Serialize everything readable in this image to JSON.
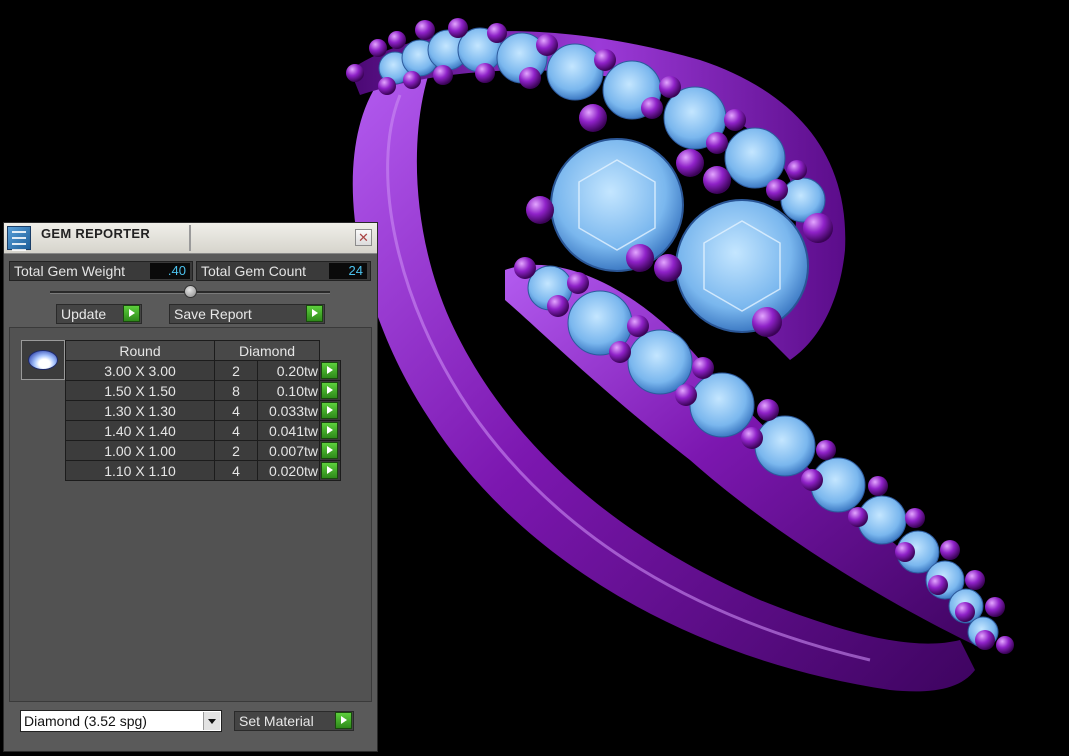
{
  "window": {
    "title": "GEM REPORTER",
    "close_glyph": "✕",
    "app_icon": "gem-reporter-icon"
  },
  "stats": {
    "total_weight_label": "Total Gem Weight",
    "total_weight_value": ".40",
    "total_count_label": "Total Gem Count",
    "total_count_value": "24"
  },
  "buttons": {
    "update": "Update",
    "save_report": "Save Report",
    "set_material": "Set Material"
  },
  "table": {
    "headers": {
      "shape": "Round",
      "material": "Diamond"
    },
    "rows": [
      {
        "size": "3.00 X 3.00",
        "count": "2",
        "weight": "0.20tw"
      },
      {
        "size": "1.50 X 1.50",
        "count": "8",
        "weight": "0.10tw"
      },
      {
        "size": "1.30 X 1.30",
        "count": "4",
        "weight": "0.033tw"
      },
      {
        "size": "1.40 X 1.40",
        "count": "4",
        "weight": "0.041tw"
      },
      {
        "size": "1.00 X 1.00",
        "count": "2",
        "weight": "0.007tw"
      },
      {
        "size": "1.10 X 1.10",
        "count": "4",
        "weight": "0.020tw"
      }
    ]
  },
  "material_select": {
    "value": "Diamond     (3.52 spg)"
  },
  "colors": {
    "metal": "#8a1fb8",
    "metal_highlight": "#d68cff",
    "gem": "#7fbff2",
    "value_text": "#4cc2ee",
    "go_button": "#3fae26"
  },
  "scene": {
    "object": "ring"
  }
}
